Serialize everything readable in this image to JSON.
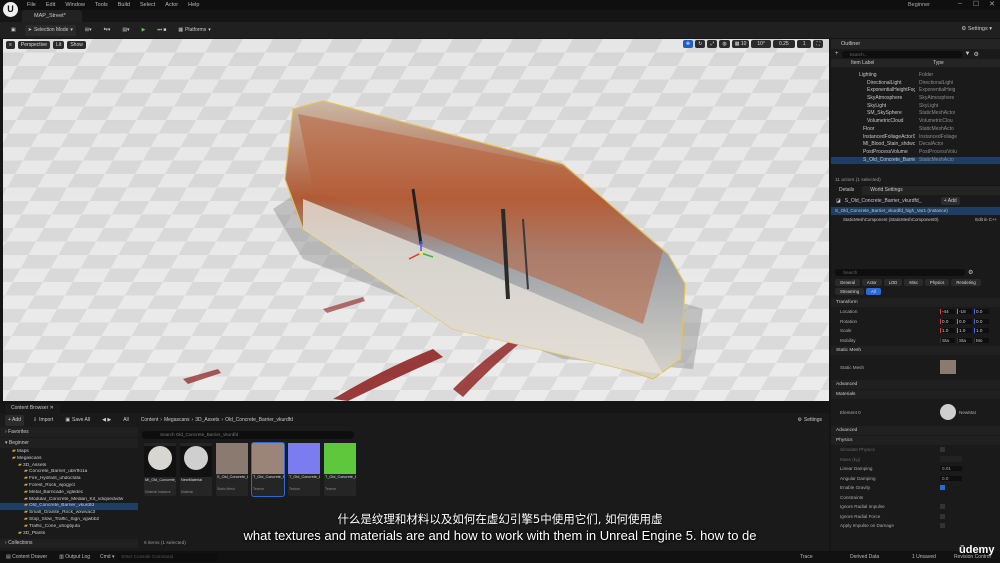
{
  "window": {
    "tab_title": "MAP_Street*",
    "mode_label": "Beginner",
    "logo": "U"
  },
  "menu": [
    "File",
    "Edit",
    "Window",
    "Tools",
    "Build",
    "Select",
    "Actor",
    "Help"
  ],
  "toolbar": {
    "selection_mode": "Selection Mode",
    "platforms": "Platforms",
    "settings": "Settings"
  },
  "viewport": {
    "perspective": "Perspective",
    "lit": "Lit",
    "show": "Show",
    "snap_angle": "10°",
    "snap_scale": "0.25",
    "camera_speed": "1"
  },
  "outliner": {
    "tab": "Outliner",
    "search_placeholder": "Search...",
    "col_label": "Item Label",
    "col_type": "Type",
    "rows": [
      {
        "name": "Lighting",
        "type": "Folder"
      },
      {
        "name": "DirectionalLight",
        "type": "DirectionalLight"
      },
      {
        "name": "ExponentialHeightFog",
        "type": "ExponentialHeig"
      },
      {
        "name": "SkyAtmosphere",
        "type": "SkyAtmosphere"
      },
      {
        "name": "SkyLight",
        "type": "SkyLight"
      },
      {
        "name": "SM_SkySphere",
        "type": "StaticMeshActor"
      },
      {
        "name": "VolumetricCloud",
        "type": "VolumetricClou"
      },
      {
        "name": "Floor",
        "type": "StaticMeshActo"
      },
      {
        "name": "InstancedFoliageActor0",
        "type": "InstancedFoliage"
      },
      {
        "name": "MI_Blood_Stain_shdwcdwc_2K",
        "type": "DecalActor"
      },
      {
        "name": "PostProcessVolume",
        "type": "PostProcessVolu"
      },
      {
        "name": "S_Old_Concrete_Barrier_vkurdfd_h",
        "type": "StaticMeshActo"
      }
    ],
    "footer": "11 actors (1 selected)"
  },
  "details": {
    "tab_details": "Details",
    "tab_world": "World Settings",
    "actor_name": "S_Old_Concrete_Barrier_vkurdfd_",
    "add": "+ Add",
    "instance": "S_Old_Concrete_Barrier_vkurdfd_high_Var1 (Instance)",
    "component": "StaticMeshComponent (StaticMeshComponent0)",
    "edit_cpp": "Edit in C++",
    "search_placeholder": "Search",
    "filters_row1": [
      "General",
      "Actor",
      "LOD",
      "Misc",
      "Physics",
      "Rendering"
    ],
    "filters_row2": [
      "Streaming",
      "All"
    ],
    "transform_header": "Transform",
    "location_label": "Location",
    "location": [
      "-44",
      "-18",
      "0.0"
    ],
    "rotation_label": "Rotation",
    "rotation": [
      "0.0",
      "0.0",
      "0.0"
    ],
    "scale_label": "Scale",
    "scale": [
      "1.0",
      "1.0",
      "1.0"
    ],
    "mobility_label": "Mobility",
    "mobility": [
      "Sta",
      "Sta",
      "Mo"
    ],
    "static_mesh_header": "Static Mesh",
    "static_mesh_label": "Static Mesh",
    "advanced": "Advanced",
    "materials_header": "Materials",
    "element0": "Element 0",
    "material_name": "NewMat",
    "advanced2": "Advanced",
    "physics_header": "Physics",
    "simulate_physics": "Simulate Physics",
    "mass_kg": "Mass (kg)",
    "linear_damping": "Linear Damping",
    "linear_damping_val": "0.01",
    "angular_damping": "Angular Damping",
    "angular_damping_val": "0.0",
    "enable_gravity": "Enable Gravity",
    "constraints": "Constraints",
    "ignore_radial_impulse": "Ignore Radial Impulse",
    "ignore_radial_force": "Ignore Radial Force",
    "apply_impulse": "Apply Impulse on Damage"
  },
  "content_browser": {
    "tab": "Content Browser",
    "add": "+ Add",
    "import": "Import",
    "save_all": "Save All",
    "all": "All",
    "breadcrumb": [
      "Content",
      "Megascans",
      "3D_Assets",
      "Old_Concrete_Barrier_vkurdfd"
    ],
    "settings": "Settings",
    "favorites": "Favorites",
    "beginner": "Beginner",
    "collections": "Collections",
    "search_placeholder": "Search Old_Concrete_Barrier_vkurdfd",
    "folders": [
      {
        "name": "Maps",
        "depth": 2
      },
      {
        "name": "Megascans",
        "depth": 2
      },
      {
        "name": "3D_Assets",
        "depth": 3
      },
      {
        "name": "Concrete_Barrier_ubrrffo1a",
        "depth": 4
      },
      {
        "name": "Fire_Hydrant_uhdocfafa",
        "depth": 4
      },
      {
        "name": "Forest_Rock_wjogyct",
        "depth": 4
      },
      {
        "name": "Metal_Barricade_vgledec",
        "depth": 4
      },
      {
        "name": "Modular_Concrete_Median_Kit_vdiqoedvdw",
        "depth": 4
      },
      {
        "name": "Old_Concrete_Barrier_vkurdfd",
        "depth": 4
      },
      {
        "name": "Small_Granite_Rock_wxwvac3",
        "depth": 4
      },
      {
        "name": "Stop_Slow_Traffic_Sign_vgwbb2",
        "depth": 4
      },
      {
        "name": "Traffic_Cone_uhogbjufa",
        "depth": 4
      },
      {
        "name": "3D_Plants",
        "depth": 3
      }
    ],
    "assets": [
      {
        "label": "MI_Old_Concrete_Barrier_vkur..",
        "type": "Material Instance",
        "color": "#d8d6d0"
      },
      {
        "label": "NewMaterial",
        "type": "Material",
        "color": "#cfcfcf"
      },
      {
        "label": "S_Old_Concrete_Barrier_vkur..",
        "type": "Static Mesh",
        "color": "#8a7a70"
      },
      {
        "label": "T_Old_Concrete_Barrier_vkur..",
        "type": "Texture",
        "color": "#9a8578"
      },
      {
        "label": "T_Old_Concrete_Barrier_vkur..",
        "type": "Texture",
        "color": "#7a7cf0"
      },
      {
        "label": "T_Old_Concrete_Barrier_vkur..",
        "type": "Texture",
        "color": "#5ec83a"
      }
    ],
    "footer": "6 items (1 selected)"
  },
  "bottom": {
    "content_drawer": "Content Drawer",
    "output_log": "Output Log",
    "cmd": "Cmd",
    "console_placeholder": "Enter Console Command",
    "trace": "Trace",
    "derived_data": "Derived Data",
    "unsaved": "1 Unsaved",
    "revision": "Revision Control"
  },
  "subtitles": {
    "cn": "什么是纹理和材料以及如何在虚幻引擎5中使用它们, 如何使用虚",
    "en": "what textures and materials are and how to work with them in Unreal Engine 5. how to de"
  },
  "watermark": "ūdemy"
}
